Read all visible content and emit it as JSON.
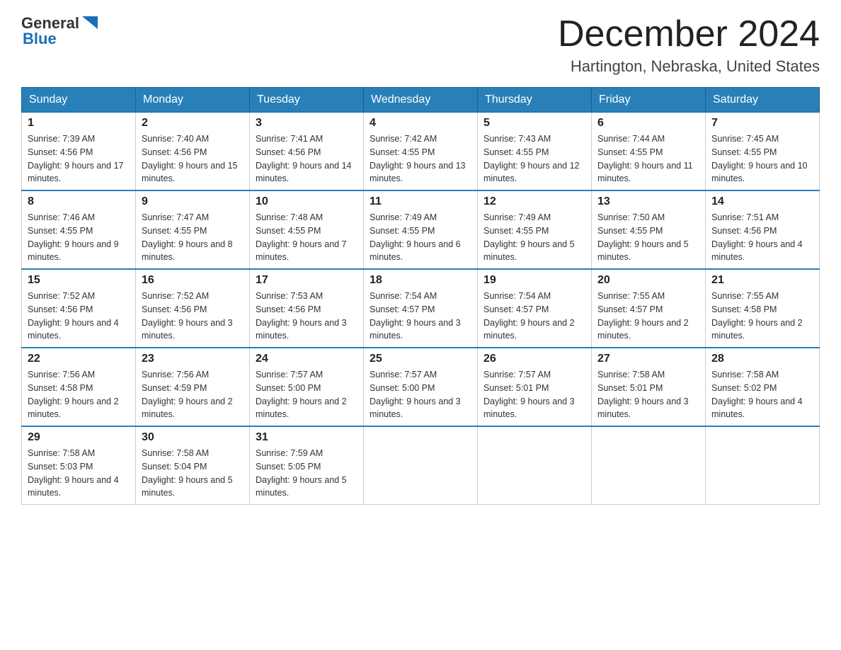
{
  "header": {
    "logo_general": "General",
    "logo_blue": "Blue",
    "month_year": "December 2024",
    "location": "Hartington, Nebraska, United States"
  },
  "weekdays": [
    "Sunday",
    "Monday",
    "Tuesday",
    "Wednesday",
    "Thursday",
    "Friday",
    "Saturday"
  ],
  "weeks": [
    [
      {
        "day": "1",
        "sunrise": "Sunrise: 7:39 AM",
        "sunset": "Sunset: 4:56 PM",
        "daylight": "Daylight: 9 hours and 17 minutes."
      },
      {
        "day": "2",
        "sunrise": "Sunrise: 7:40 AM",
        "sunset": "Sunset: 4:56 PM",
        "daylight": "Daylight: 9 hours and 15 minutes."
      },
      {
        "day": "3",
        "sunrise": "Sunrise: 7:41 AM",
        "sunset": "Sunset: 4:56 PM",
        "daylight": "Daylight: 9 hours and 14 minutes."
      },
      {
        "day": "4",
        "sunrise": "Sunrise: 7:42 AM",
        "sunset": "Sunset: 4:55 PM",
        "daylight": "Daylight: 9 hours and 13 minutes."
      },
      {
        "day": "5",
        "sunrise": "Sunrise: 7:43 AM",
        "sunset": "Sunset: 4:55 PM",
        "daylight": "Daylight: 9 hours and 12 minutes."
      },
      {
        "day": "6",
        "sunrise": "Sunrise: 7:44 AM",
        "sunset": "Sunset: 4:55 PM",
        "daylight": "Daylight: 9 hours and 11 minutes."
      },
      {
        "day": "7",
        "sunrise": "Sunrise: 7:45 AM",
        "sunset": "Sunset: 4:55 PM",
        "daylight": "Daylight: 9 hours and 10 minutes."
      }
    ],
    [
      {
        "day": "8",
        "sunrise": "Sunrise: 7:46 AM",
        "sunset": "Sunset: 4:55 PM",
        "daylight": "Daylight: 9 hours and 9 minutes."
      },
      {
        "day": "9",
        "sunrise": "Sunrise: 7:47 AM",
        "sunset": "Sunset: 4:55 PM",
        "daylight": "Daylight: 9 hours and 8 minutes."
      },
      {
        "day": "10",
        "sunrise": "Sunrise: 7:48 AM",
        "sunset": "Sunset: 4:55 PM",
        "daylight": "Daylight: 9 hours and 7 minutes."
      },
      {
        "day": "11",
        "sunrise": "Sunrise: 7:49 AM",
        "sunset": "Sunset: 4:55 PM",
        "daylight": "Daylight: 9 hours and 6 minutes."
      },
      {
        "day": "12",
        "sunrise": "Sunrise: 7:49 AM",
        "sunset": "Sunset: 4:55 PM",
        "daylight": "Daylight: 9 hours and 5 minutes."
      },
      {
        "day": "13",
        "sunrise": "Sunrise: 7:50 AM",
        "sunset": "Sunset: 4:55 PM",
        "daylight": "Daylight: 9 hours and 5 minutes."
      },
      {
        "day": "14",
        "sunrise": "Sunrise: 7:51 AM",
        "sunset": "Sunset: 4:56 PM",
        "daylight": "Daylight: 9 hours and 4 minutes."
      }
    ],
    [
      {
        "day": "15",
        "sunrise": "Sunrise: 7:52 AM",
        "sunset": "Sunset: 4:56 PM",
        "daylight": "Daylight: 9 hours and 4 minutes."
      },
      {
        "day": "16",
        "sunrise": "Sunrise: 7:52 AM",
        "sunset": "Sunset: 4:56 PM",
        "daylight": "Daylight: 9 hours and 3 minutes."
      },
      {
        "day": "17",
        "sunrise": "Sunrise: 7:53 AM",
        "sunset": "Sunset: 4:56 PM",
        "daylight": "Daylight: 9 hours and 3 minutes."
      },
      {
        "day": "18",
        "sunrise": "Sunrise: 7:54 AM",
        "sunset": "Sunset: 4:57 PM",
        "daylight": "Daylight: 9 hours and 3 minutes."
      },
      {
        "day": "19",
        "sunrise": "Sunrise: 7:54 AM",
        "sunset": "Sunset: 4:57 PM",
        "daylight": "Daylight: 9 hours and 2 minutes."
      },
      {
        "day": "20",
        "sunrise": "Sunrise: 7:55 AM",
        "sunset": "Sunset: 4:57 PM",
        "daylight": "Daylight: 9 hours and 2 minutes."
      },
      {
        "day": "21",
        "sunrise": "Sunrise: 7:55 AM",
        "sunset": "Sunset: 4:58 PM",
        "daylight": "Daylight: 9 hours and 2 minutes."
      }
    ],
    [
      {
        "day": "22",
        "sunrise": "Sunrise: 7:56 AM",
        "sunset": "Sunset: 4:58 PM",
        "daylight": "Daylight: 9 hours and 2 minutes."
      },
      {
        "day": "23",
        "sunrise": "Sunrise: 7:56 AM",
        "sunset": "Sunset: 4:59 PM",
        "daylight": "Daylight: 9 hours and 2 minutes."
      },
      {
        "day": "24",
        "sunrise": "Sunrise: 7:57 AM",
        "sunset": "Sunset: 5:00 PM",
        "daylight": "Daylight: 9 hours and 2 minutes."
      },
      {
        "day": "25",
        "sunrise": "Sunrise: 7:57 AM",
        "sunset": "Sunset: 5:00 PM",
        "daylight": "Daylight: 9 hours and 3 minutes."
      },
      {
        "day": "26",
        "sunrise": "Sunrise: 7:57 AM",
        "sunset": "Sunset: 5:01 PM",
        "daylight": "Daylight: 9 hours and 3 minutes."
      },
      {
        "day": "27",
        "sunrise": "Sunrise: 7:58 AM",
        "sunset": "Sunset: 5:01 PM",
        "daylight": "Daylight: 9 hours and 3 minutes."
      },
      {
        "day": "28",
        "sunrise": "Sunrise: 7:58 AM",
        "sunset": "Sunset: 5:02 PM",
        "daylight": "Daylight: 9 hours and 4 minutes."
      }
    ],
    [
      {
        "day": "29",
        "sunrise": "Sunrise: 7:58 AM",
        "sunset": "Sunset: 5:03 PM",
        "daylight": "Daylight: 9 hours and 4 minutes."
      },
      {
        "day": "30",
        "sunrise": "Sunrise: 7:58 AM",
        "sunset": "Sunset: 5:04 PM",
        "daylight": "Daylight: 9 hours and 5 minutes."
      },
      {
        "day": "31",
        "sunrise": "Sunrise: 7:59 AM",
        "sunset": "Sunset: 5:05 PM",
        "daylight": "Daylight: 9 hours and 5 minutes."
      },
      null,
      null,
      null,
      null
    ]
  ]
}
